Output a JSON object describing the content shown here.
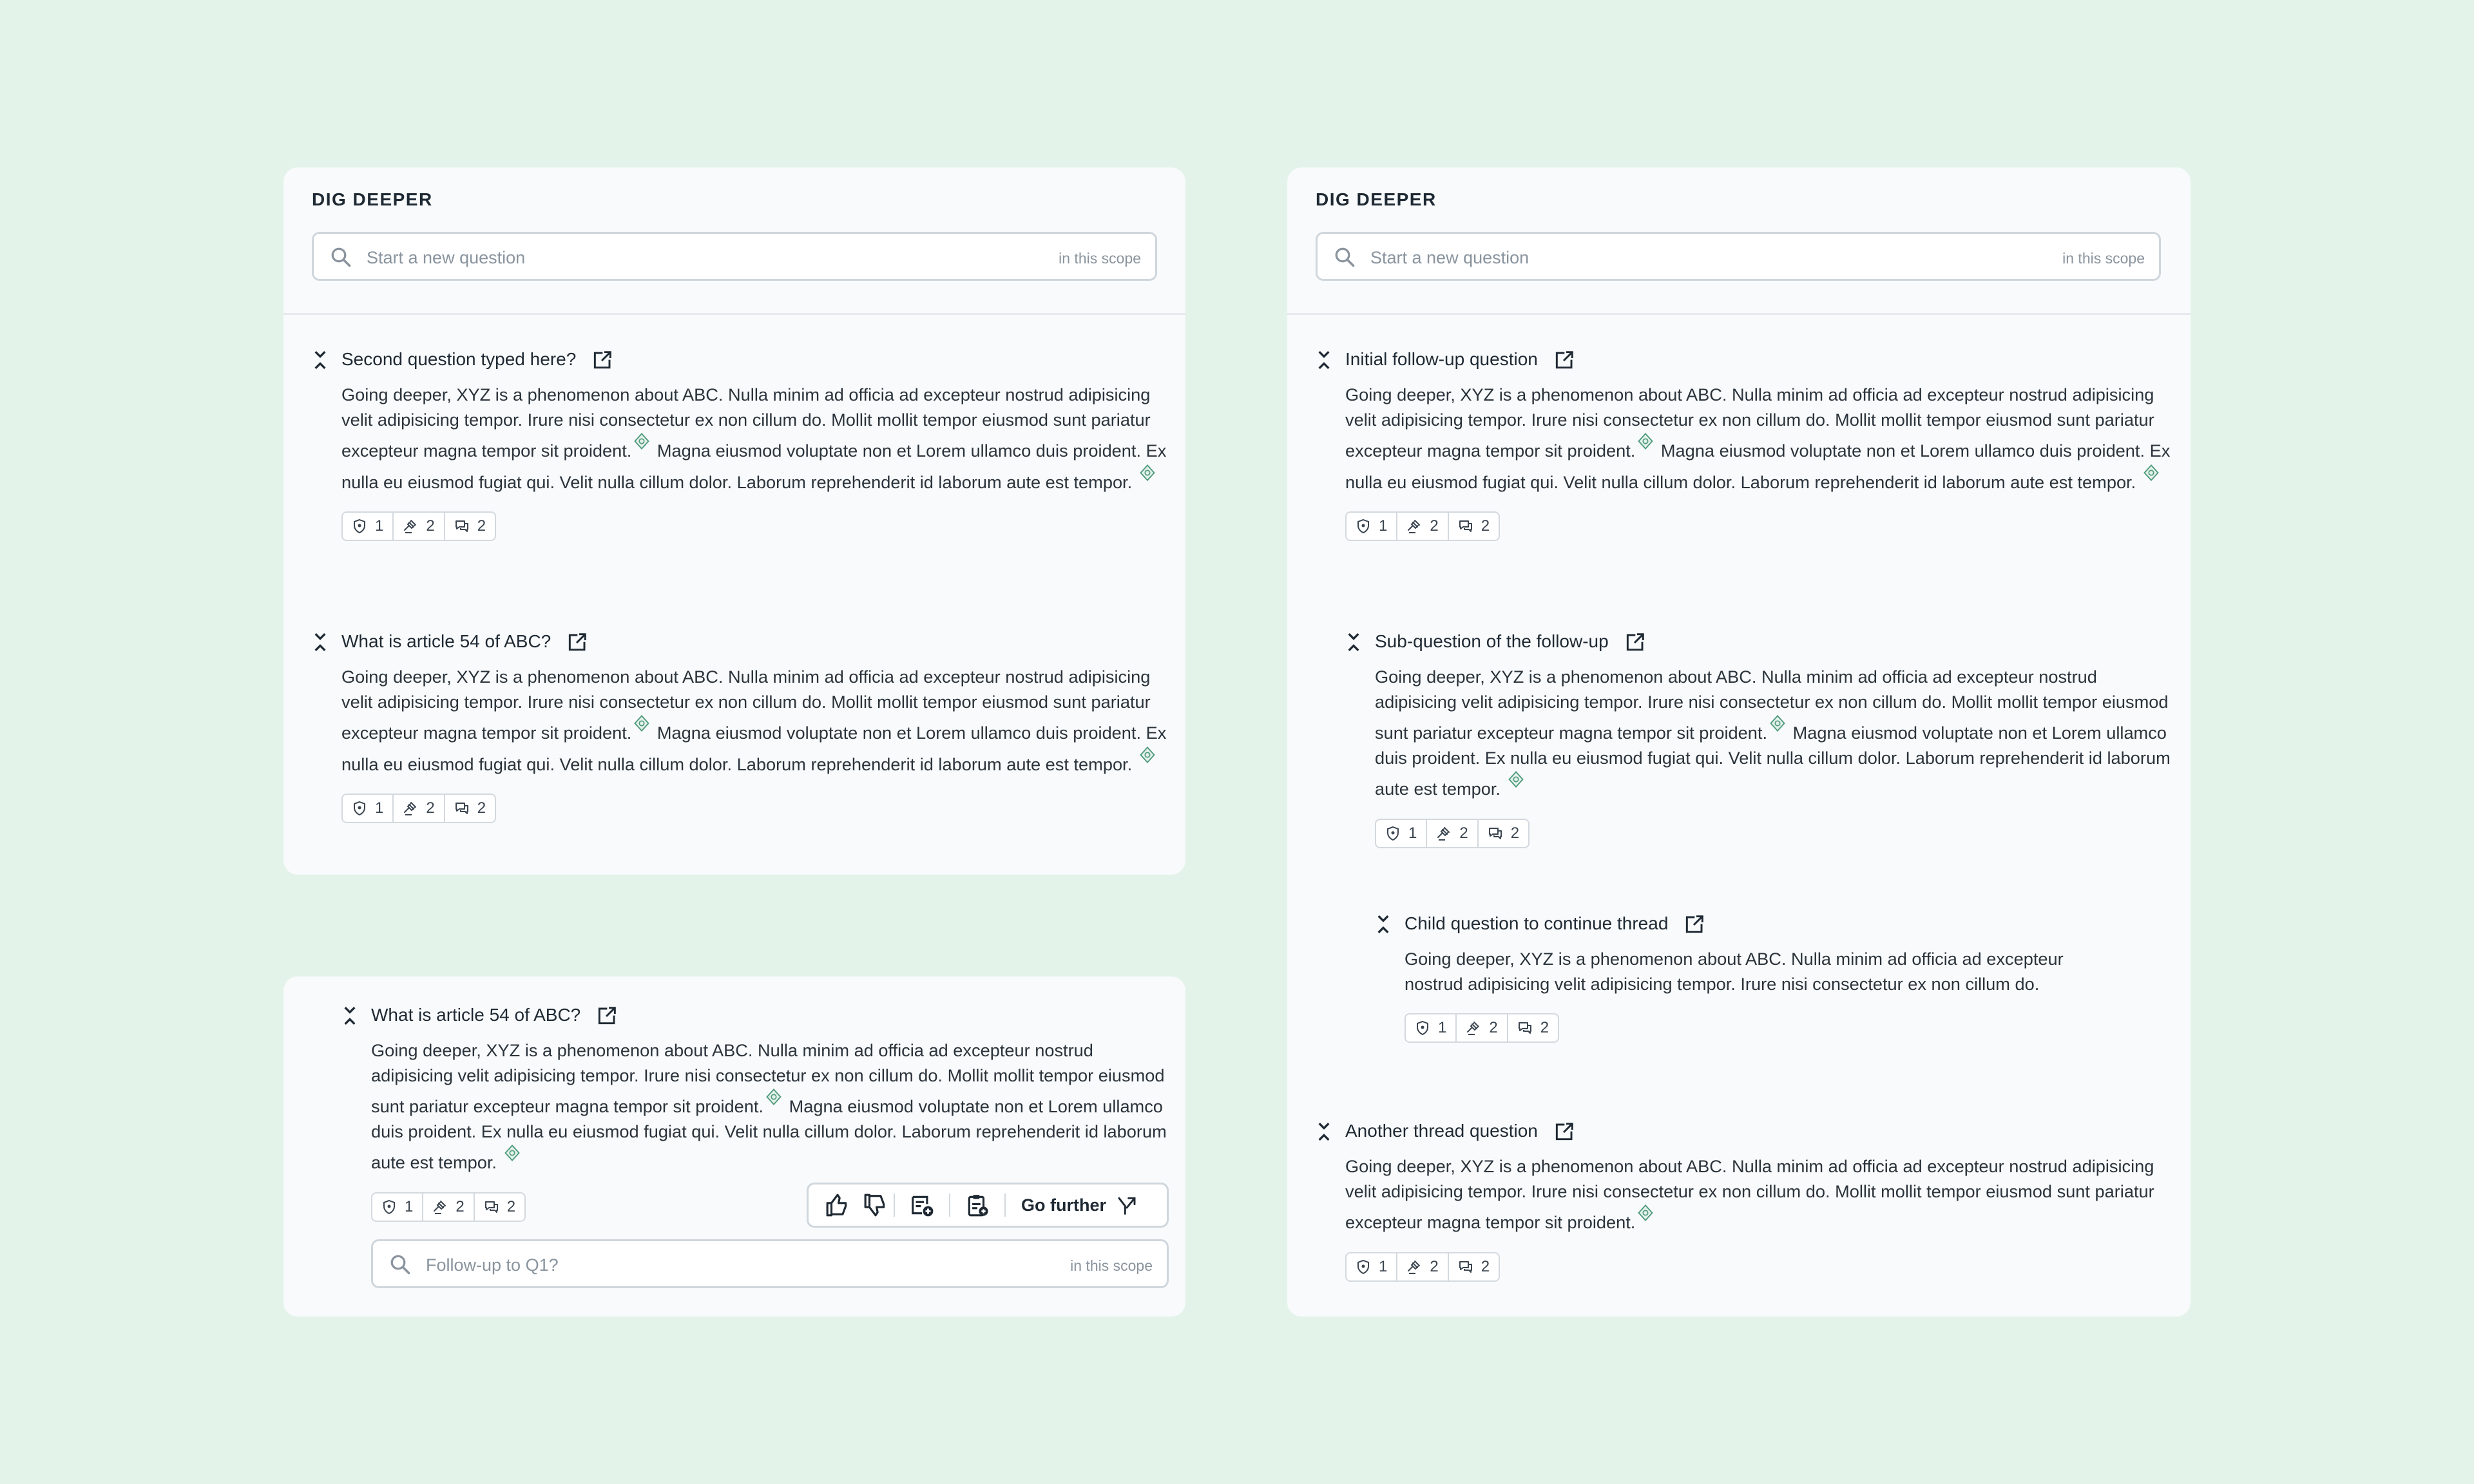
{
  "panels": {
    "left": {
      "title": "DIG DEEPER",
      "search": {
        "placeholder": "Start a new question",
        "scope": "in this scope"
      },
      "questions": [
        {
          "title": "Second question typed here?",
          "body": [
            "Going deeper, XYZ is a phenomenon about ABC. Nulla minim ad officia ad excepteur nostrud adipisicing velit adipisicing tempor. Irure nisi consectetur ex non cillum do. Mollit mollit tempor eiusmod sunt pariatur excepteur magna tempor sit proident.",
            " Magna eiusmod voluptate non et Lorem ullamco duis proident. Ex nulla eu eiusmod fugiat qui. Velit nulla cillum dolor. Laborum reprehenderit id laborum aute est tempor. "
          ],
          "stats": {
            "shield": "1",
            "gavel": "2",
            "comments": "2"
          }
        },
        {
          "title": "What is article 54 of ABC?",
          "body": [
            "Going deeper, XYZ is a phenomenon about ABC. Nulla minim ad officia ad excepteur nostrud adipisicing velit adipisicing tempor. Irure nisi consectetur ex non cillum do. Mollit mollit tempor eiusmod sunt pariatur excepteur magna tempor sit proident.",
            " Magna eiusmod voluptate non et Lorem ullamco duis proident. Ex nulla eu eiusmod fugiat qui. Velit nulla cillum dolor. Laborum reprehenderit id laborum aute est tempor. "
          ],
          "stats": {
            "shield": "1",
            "gavel": "2",
            "comments": "2"
          }
        }
      ]
    },
    "bottom": {
      "question": {
        "title": "What is article 54 of ABC?",
        "body": [
          "Going deeper, XYZ is a phenomenon about ABC. Nulla minim ad officia ad excepteur nostrud adipisicing velit adipisicing tempor. Irure nisi consectetur ex non cillum do. Mollit mollit tempor eiusmod sunt pariatur excepteur magna tempor sit proident.",
          " Magna eiusmod voluptate non et Lorem ullamco duis proident. Ex nulla eu eiusmod fugiat qui. Velit nulla cillum dolor. Laborum reprehenderit id laborum aute est tempor. "
        ],
        "stats": {
          "shield": "1",
          "gavel": "2",
          "comments": "2"
        }
      },
      "actions": {
        "go_further": "Go further"
      },
      "followup": {
        "placeholder": "Follow-up to Q1?",
        "scope": "in this scope"
      }
    },
    "right": {
      "title": "DIG DEEPER",
      "search": {
        "placeholder": "Start a new question",
        "scope": "in this scope"
      },
      "questions": [
        {
          "title": "Initial follow-up question",
          "body": [
            "Going deeper, XYZ is a phenomenon about ABC. Nulla minim ad officia ad excepteur nostrud adipisicing velit adipisicing tempor. Irure nisi consectetur ex non cillum do. Mollit mollit tempor eiusmod sunt pariatur excepteur magna tempor sit proident.",
            " Magna eiusmod voluptate non et Lorem ullamco duis proident. Ex nulla eu eiusmod fugiat qui. Velit nulla cillum dolor. Laborum reprehenderit id laborum aute est tempor. "
          ],
          "stats": {
            "shield": "1",
            "gavel": "2",
            "comments": "2"
          }
        },
        {
          "title": "Sub-question of the follow-up",
          "body": [
            "Going deeper, XYZ is a phenomenon about ABC. Nulla minim ad officia ad excepteur nostrud adipisicing velit adipisicing tempor. Irure nisi consectetur ex non cillum do. Mollit mollit tempor eiusmod sunt pariatur excepteur magna tempor sit proident.",
            " Magna eiusmod voluptate non et Lorem ullamco duis proident. Ex nulla eu eiusmod fugiat qui. Velit nulla cillum dolor. Laborum reprehenderit id laborum aute est tempor. "
          ],
          "stats": {
            "shield": "1",
            "gavel": "2",
            "comments": "2"
          }
        },
        {
          "title": "Child question to continue thread",
          "body": [
            "Going deeper, XYZ is a phenomenon about ABC. Nulla minim ad officia ad excepteur nostrud adipisicing velit adipisicing tempor. Irure nisi consectetur ex non cillum do."
          ],
          "stats": {
            "shield": "1",
            "gavel": "2",
            "comments": "2"
          }
        },
        {
          "title": "Another thread question",
          "body": [
            "Going deeper, XYZ is a phenomenon about ABC. Nulla minim ad officia ad excepteur nostrud adipisicing velit adipisicing tempor. Irure nisi consectetur ex non cillum do. Mollit mollit tempor eiusmod sunt pariatur excepteur magna tempor sit proident."
          ],
          "stats": {
            "shield": "1",
            "gavel": "2",
            "comments": "2"
          }
        }
      ]
    }
  },
  "colors": {
    "background": "#e3f3ea",
    "panel": "#f8fafb",
    "citation": "#4f9a7c"
  },
  "icons": [
    "search-icon",
    "collapse-icon",
    "external-link-icon",
    "citation-icon",
    "shield-icon",
    "gavel-icon",
    "comments-icon",
    "thumbs-up-icon",
    "thumbs-down-icon",
    "add-note-icon",
    "clipboard-icon",
    "branch-arrow-icon"
  ]
}
